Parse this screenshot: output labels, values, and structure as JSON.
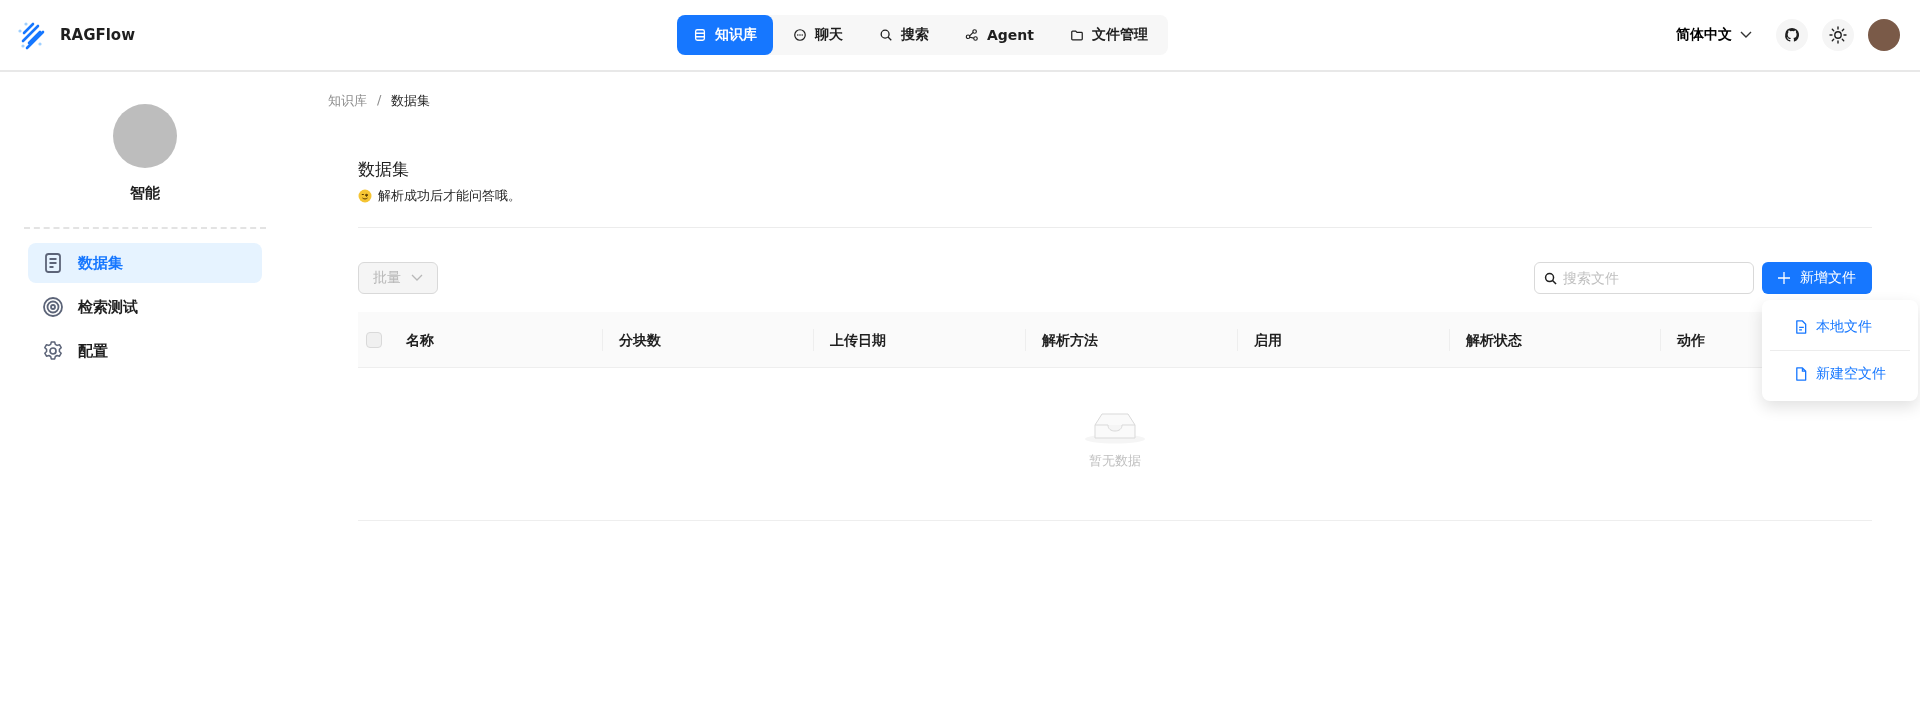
{
  "header": {
    "logo_text": "RAGFlow",
    "nav": [
      {
        "label": "知识库",
        "selected": true
      },
      {
        "label": "聊天",
        "selected": false
      },
      {
        "label": "搜索",
        "selected": false
      },
      {
        "label": "Agent",
        "selected": false
      },
      {
        "label": "文件管理",
        "selected": false
      }
    ],
    "language": "简体中文"
  },
  "sidebar": {
    "name": "智能",
    "items": [
      {
        "label": "数据集",
        "selected": true
      },
      {
        "label": "检索测试",
        "selected": false
      },
      {
        "label": "配置",
        "selected": false
      }
    ]
  },
  "breadcrumb": [
    "知识库",
    "数据集"
  ],
  "breadcrumb_separator": "/",
  "title": "数据集",
  "subtitle": "解析成功后才能问答哦。",
  "toolbar": {
    "batch": {
      "label": "批量",
      "disabled": true
    },
    "search": {
      "placeholder": "搜索文件"
    },
    "new_button": "新增文件",
    "menu": [
      "本地文件",
      "新建空文件"
    ]
  },
  "table": {
    "columns": [
      "名称",
      "分块数",
      "上传日期",
      "解析方法",
      "启用",
      "解析状态",
      "动作"
    ],
    "select_all": {
      "checked": false
    },
    "empty_text": "暂无数据"
  }
}
